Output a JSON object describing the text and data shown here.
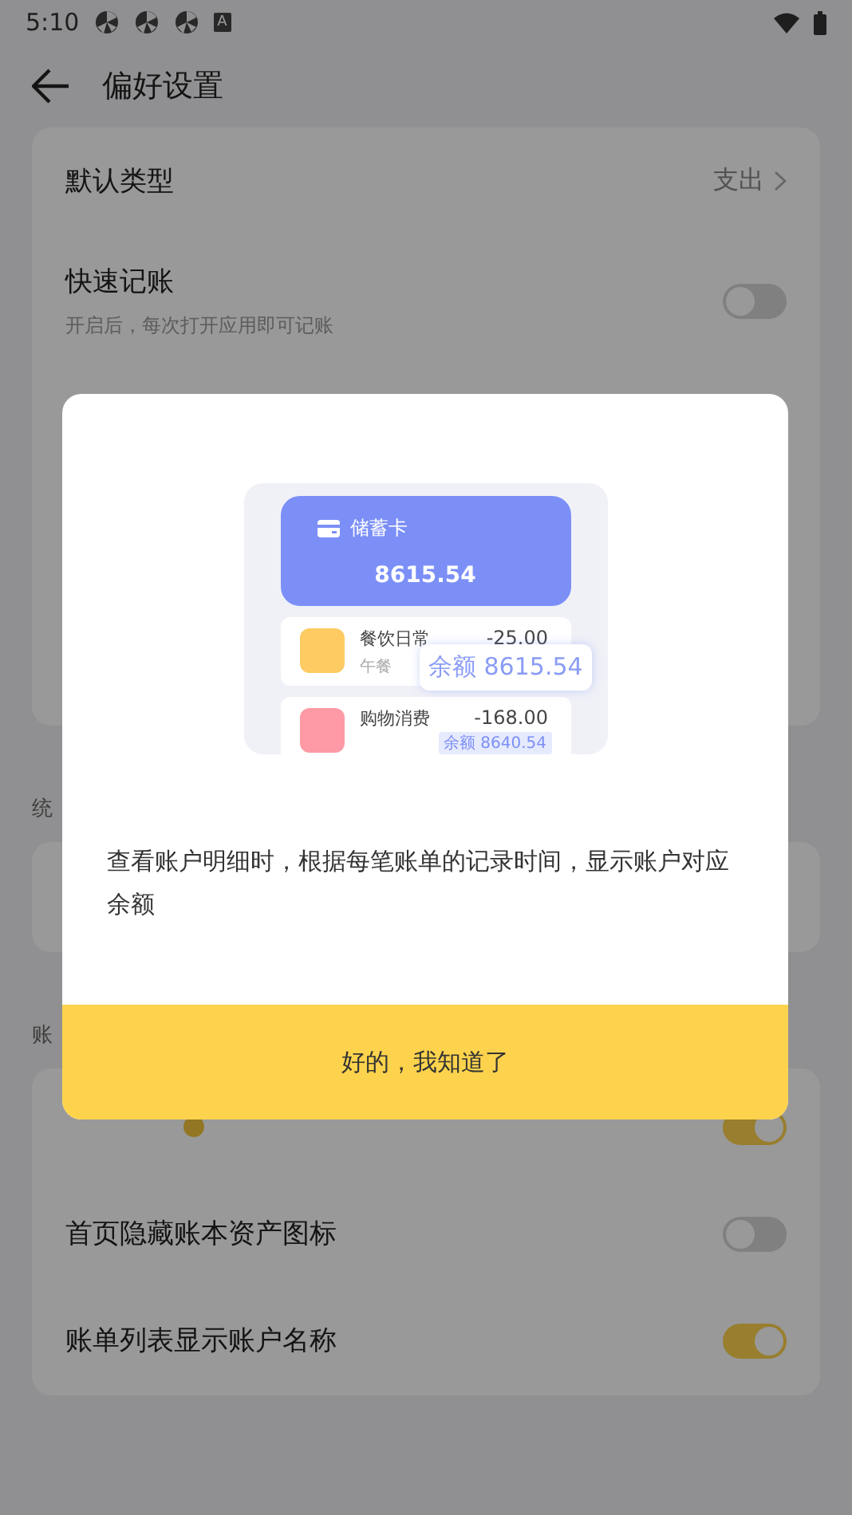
{
  "status_bar": {
    "time": "5:10",
    "badge_letter": "A"
  },
  "header": {
    "title": "偏好设置"
  },
  "sections": [
    {
      "rows": [
        {
          "kind": "link",
          "title": "默认类型",
          "value": "支出"
        },
        {
          "kind": "toggle",
          "title": "快速记账",
          "subtitle": "开启后，每次打开应用即可记账",
          "on": false
        }
      ]
    },
    {
      "label": "统"
    },
    {
      "label": "账",
      "rows": [
        {
          "kind": "toggle",
          "help": true,
          "on": true
        },
        {
          "kind": "toggle",
          "title": "首页隐藏账本资产图标",
          "on": false
        },
        {
          "kind": "toggle",
          "title": "账单列表显示账户名称",
          "on": true
        }
      ]
    }
  ],
  "dialog": {
    "illustration": {
      "card_title": "储蓄卡",
      "card_amount": "8615.54",
      "items": [
        {
          "name": "餐饮日常",
          "note": "午餐",
          "amount": "-25.00",
          "color": "#fdcb62"
        },
        {
          "name": "购物消费",
          "amount": "-168.00",
          "balance": "余额 8640.54",
          "color": "#fe9aa5"
        }
      ],
      "tooltip": "余额 8615.54"
    },
    "message": "查看账户明细时，根据每笔账单的记录时间，显示账户对应余额",
    "button": "好的，我知道了"
  }
}
